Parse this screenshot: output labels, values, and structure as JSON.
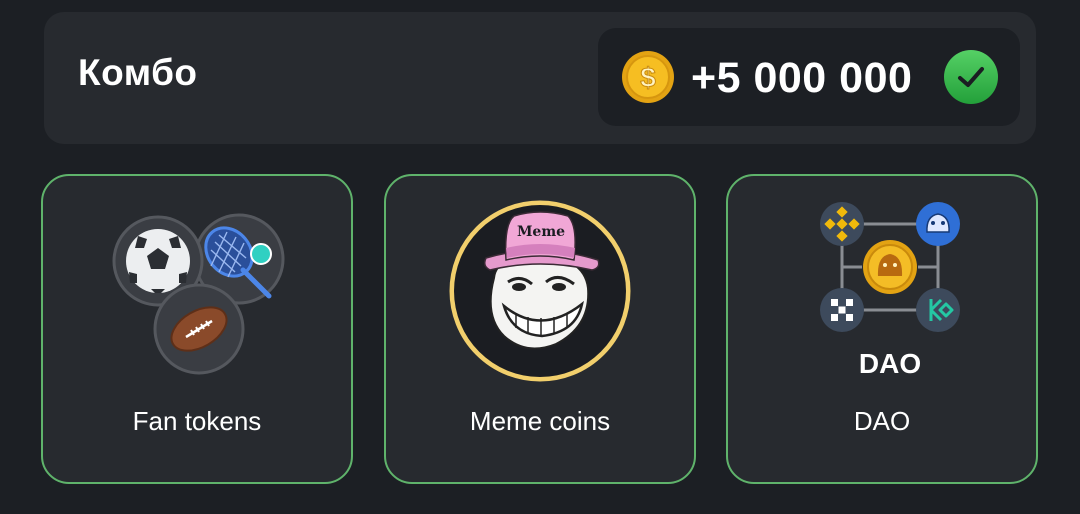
{
  "combo": {
    "title": "Комбо",
    "reward": "+5 000 000",
    "coin_icon": "dollar-coin-icon",
    "status_icon": "check-icon",
    "colors": {
      "coin": "#f5b51b",
      "check": "#3fbf4f",
      "card_border": "#5fb36b"
    }
  },
  "cards": [
    {
      "label": "Fan tokens",
      "icon": "sports-balls-icon"
    },
    {
      "label": "Meme coins",
      "icon": "troll-face-meme-icon",
      "hat_text": "Meme"
    },
    {
      "label": "DAO",
      "icon": "dao-network-icon",
      "caption": "DAO"
    }
  ]
}
